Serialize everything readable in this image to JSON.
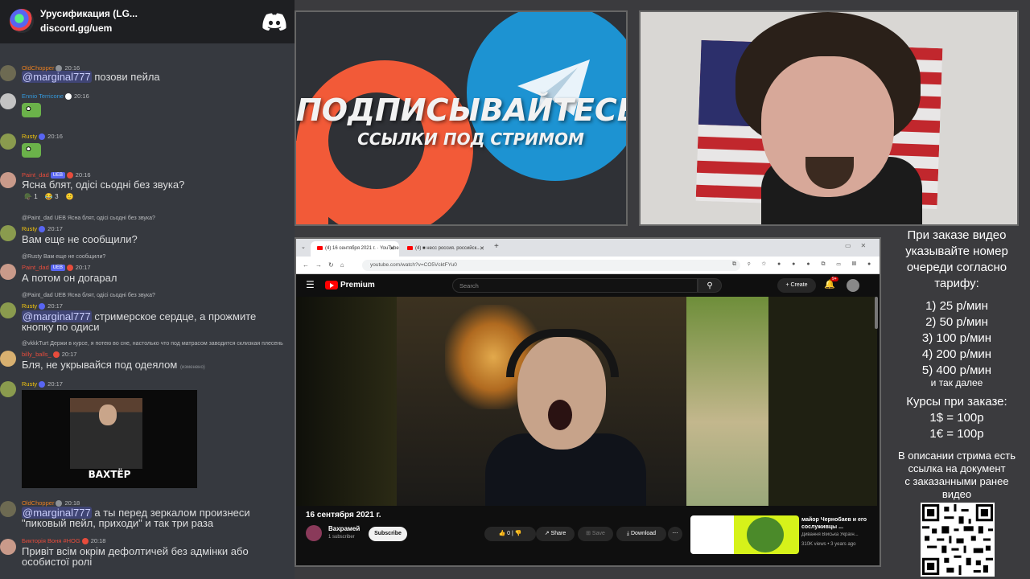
{
  "discord": {
    "server_name": "Урусификация (LG...",
    "invite": "discord.gg/uem",
    "messages": [
      {
        "user": "OldChopper",
        "color": "#e67e22",
        "time": "20:16",
        "av": "#6d6a52",
        "text_pre": "",
        "mention": "@marginal777",
        "text": " позови пейла"
      },
      {
        "user": "Ennio Terricone",
        "color": "#3498db",
        "time": "20:16",
        "av": "#c3c3c3",
        "text_pre": "",
        "mention": "",
        "text": ""
      },
      {
        "user": "Rusty",
        "color": "#f1c40f",
        "time": "20:16",
        "av": "#8a9b4e",
        "text_pre": "",
        "mention": "",
        "text": ""
      },
      {
        "user": "Paint_dad",
        "badge": "UEB",
        "color": "#e74c3c",
        "time": "20:16",
        "av": "#c99a8a",
        "text_pre": "",
        "mention": "",
        "text": "Ясна блят, одісі сьодні без звука?"
      },
      {
        "reply": "@Paint_dad UEB Ясна блят, одісі сьодні без звука?",
        "user": "Rusty",
        "color": "#f1c40f",
        "time": "20:17",
        "av": "#8a9b4e",
        "text_pre": "",
        "mention": "",
        "text": "Вам еще не сообщили?"
      },
      {
        "reply": "@Rusty Вам еще не сообщили?",
        "user": "Paint_dad",
        "badge": "UEB",
        "color": "#e74c3c",
        "time": "20:17",
        "av": "#c99a8a",
        "text_pre": "",
        "mention": "",
        "text": "А потом он догарал"
      },
      {
        "reply": "@Paint_dad UEB Ясна блят, одісі сьодні без звука?",
        "user": "Rusty",
        "color": "#f1c40f",
        "time": "20:17",
        "av": "#8a9b4e",
        "text_pre": "",
        "mention": "@marginal777",
        "text": " стримерское сердце, а прожмите",
        "text2": "кнопку по одиси"
      },
      {
        "reply": "@vkkkTurt Держи в курсе, я потею во сне, настолько что под матрасом заводится склизкая плесень",
        "user": "billy_balls_",
        "color": "#e74c3c",
        "time": "20:17",
        "av": "#d8b070",
        "text_pre": "",
        "mention": "",
        "text": "Бля, не укрывайся под одеялом",
        "edited": "(изменено)"
      },
      {
        "user": "Rusty",
        "color": "#f1c40f",
        "time": "20:17",
        "av": "#8a9b4e",
        "text_pre": "",
        "mention": "",
        "text": ""
      },
      {
        "user": "OldChopper",
        "color": "#e67e22",
        "time": "20:18",
        "av": "#6d6a52",
        "text_pre": "",
        "mention": "@marginal777",
        "text": " а ты перед зеркалом произнеси",
        "text2": "\"пиковый пейл, приходи\" и так три раза"
      },
      {
        "user": "Бикторія Воня #HOG",
        "color": "#e74c3c",
        "time": "20:18",
        "av": "#c99a8a",
        "text_pre": "",
        "mention": "",
        "text": "Привіт всім окрім дефолтичей без адмінки або",
        "text2": "особистої ролі"
      }
    ],
    "reactions": [
      {
        "emoji": "🪖",
        "count": "1"
      },
      {
        "emoji": "😂",
        "count": "3"
      },
      {
        "emoji": "🙂",
        "count": ""
      }
    ],
    "gif_caption": "ВАХТЁР"
  },
  "promo": {
    "title": "ПОДПИСЫВАЙТЕСЬ",
    "subtitle": "ССЫЛКИ ПОД СТРИМОМ"
  },
  "browser": {
    "tab1": "(4) 16 сентября 2021 г. · YouTube",
    "tab2": "(4) ■ несс россия. российск...",
    "url": "youtube.com/watch?v=CO5VcktFYu0",
    "yt": {
      "brand": "Premium",
      "search_placeholder": "Search",
      "create": "+ Create",
      "notif_count": "9+",
      "video_title": "16 сентября 2021 г.",
      "channel": "Вахрамей",
      "subs": "1 subscriber",
      "subscribe": "Subscribe",
      "likes": "👍 0   |  👎",
      "share": "↗ Share",
      "save": "⊞ Save",
      "download": "⤓ Download",
      "more": "⋯",
      "rec_title": "майор Чернобаев и его сослуживцы ...",
      "rec_channel": "Дивання Військa Україн...",
      "rec_views": "310K views • 3 years ago"
    }
  },
  "info": {
    "head": [
      "При заказе видео",
      "указывайте номер",
      "очереди согласно",
      "тарифу:"
    ],
    "rates": [
      "1) 25 р/мин",
      "2) 50 р/мин",
      "3) 100 р/мин",
      "4) 200 р/мин",
      "5) 400 р/мин"
    ],
    "etc": "и так далее",
    "courses": [
      "Курсы при заказе:",
      "1$ = 100р",
      "1€ = 100р"
    ],
    "desc": [
      "В описании стрима есть",
      "ссылка на документ",
      "с заказанными ранее",
      "видео"
    ]
  }
}
